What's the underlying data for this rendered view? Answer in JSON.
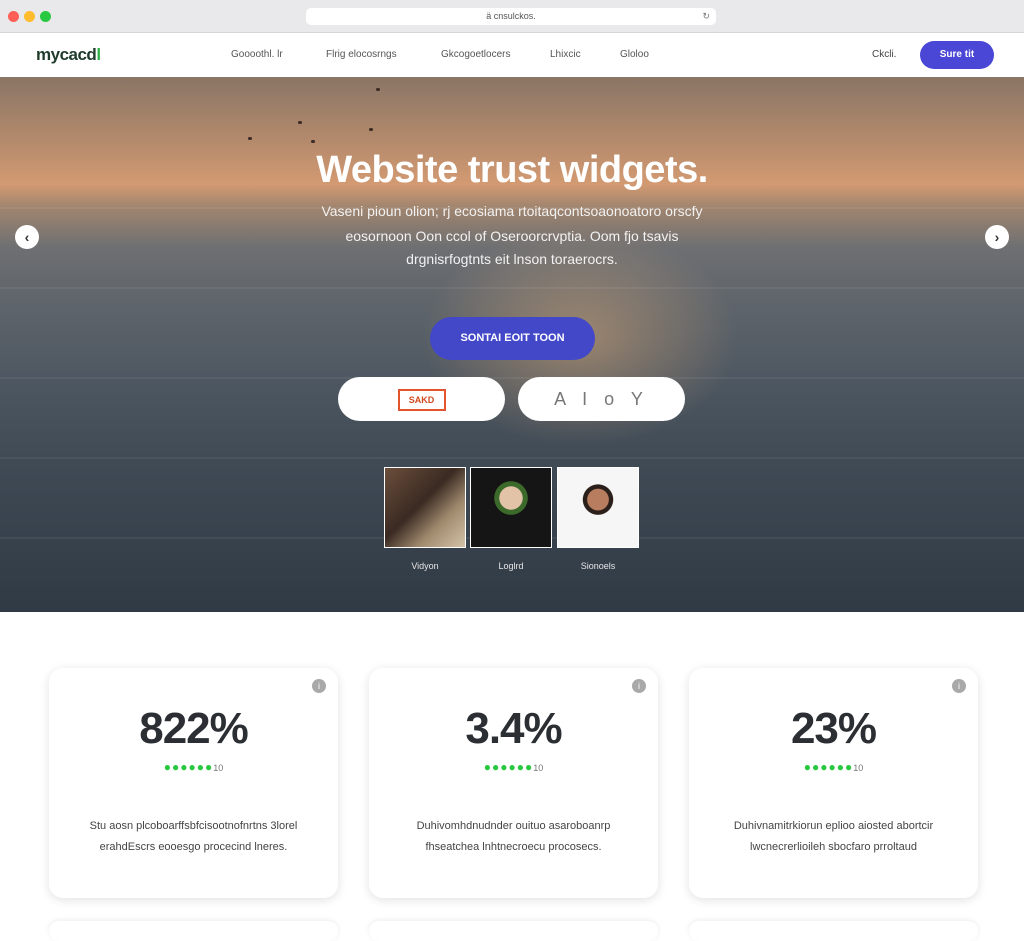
{
  "browser": {
    "url": "ä  cnsulckos.",
    "lock_icon": "lock-icon",
    "reload_icon": "reload-icon"
  },
  "nav": {
    "logo": "mycacd",
    "logo_accent": "l",
    "links": [
      "Goooothl. lr",
      "Flrig elocosrngs",
      "Gkcogoetlocers",
      "Lhixcic",
      "Gloloo"
    ],
    "right_link": "Ckcli.",
    "cta": "Sure tit"
  },
  "hero": {
    "title": "Website trust widgets.",
    "subtitle_lines": [
      "Vaseni pioun olion; rj ecosiama rtoitaqcontsoaonoatoro orscfy",
      "eosornoon Oon ccol of Oseroorcrvptia. Oom fjo tsavis",
      "drgnisrfogtnts eit lnson toraerocrs."
    ],
    "cta": "SONTAI EOIT TOON",
    "pill_left_badge": "SAKD",
    "pill_right": "A I o Y",
    "prev_icon": "chevron-left-icon",
    "next_icon": "chevron-right-icon",
    "people": [
      {
        "caption": "Vidyon"
      },
      {
        "caption": "Loglrd"
      },
      {
        "caption": "Sionoels"
      }
    ]
  },
  "stats": [
    {
      "value": "822%",
      "stars": 6,
      "star_count": "10",
      "description": "Stu aosn plcoboarffsbfcisootnofnrtns 3lorel erahdEscrs eooesgo procecind lneres."
    },
    {
      "value": "3.4%",
      "stars": 6,
      "star_count": "10",
      "description": "Duhivomhdnudnder ouituo asaroboanrp fhseatchea lnhtnecroecu procosecs."
    },
    {
      "value": "23%",
      "stars": 6,
      "star_count": "10",
      "description": "Duhivnamitrkiorun eplioo aiosted abortcir lwcnecrerlioileh sbocfaro prroltaud"
    }
  ],
  "colors": {
    "brand": "#4a46d6",
    "hero_cta": "#4348c8",
    "star": "#28c840",
    "logo_accent": "#2fb34a"
  }
}
